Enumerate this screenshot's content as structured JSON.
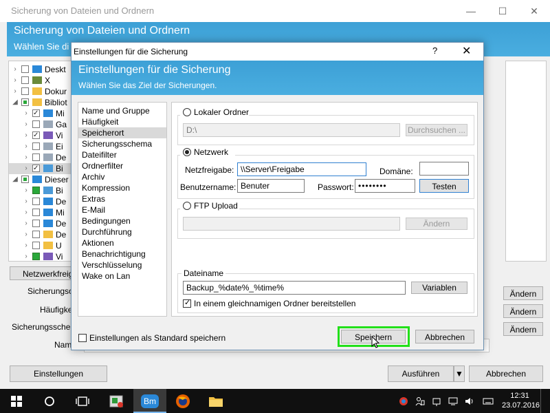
{
  "main": {
    "title": "Sicherung von Dateien und Ordnern",
    "banner_title": "Sicherung von Dateien und Ordnern",
    "banner_sub": "Wählen Sie di",
    "tree": [
      {
        "label": "Deskt",
        "depth": 0,
        "state": "none",
        "icon": "desktop"
      },
      {
        "label": "X",
        "depth": 0,
        "state": "none",
        "icon": "user"
      },
      {
        "label": "Dokur",
        "depth": 0,
        "state": "none",
        "icon": "folder"
      },
      {
        "label": "Bibliot",
        "depth": 0,
        "state": "part",
        "icon": "library",
        "expanded": true
      },
      {
        "label": "Mi",
        "depth": 1,
        "state": "checked",
        "icon": "music"
      },
      {
        "label": "Ga",
        "depth": 1,
        "state": "none",
        "icon": "doc"
      },
      {
        "label": "Vi",
        "depth": 1,
        "state": "checked",
        "icon": "video"
      },
      {
        "label": "Ei",
        "depth": 1,
        "state": "none",
        "icon": "doc"
      },
      {
        "label": "De",
        "depth": 1,
        "state": "none",
        "icon": "doc"
      },
      {
        "label": "Bi",
        "depth": 1,
        "state": "checked",
        "icon": "image",
        "selected": true
      },
      {
        "label": "Dieser",
        "depth": 0,
        "state": "part",
        "icon": "pc",
        "expanded": true
      },
      {
        "label": "Bi",
        "depth": 1,
        "state": "full",
        "icon": "image"
      },
      {
        "label": "De",
        "depth": 1,
        "state": "none",
        "icon": "download"
      },
      {
        "label": "Mi",
        "depth": 1,
        "state": "none",
        "icon": "music"
      },
      {
        "label": "De",
        "depth": 1,
        "state": "none",
        "icon": "desktop"
      },
      {
        "label": "De",
        "depth": 1,
        "state": "none",
        "icon": "folder"
      },
      {
        "label": "U",
        "depth": 1,
        "state": "none",
        "icon": "folder"
      },
      {
        "label": "Vi",
        "depth": 1,
        "state": "full",
        "icon": "video"
      }
    ],
    "netzwerkfreigabe_btn": "Netzwerkfreiga",
    "label_sicherungsort": "Sicherungsor",
    "label_haeufigkeit": "Häufigkei",
    "label_schema": "Sicherungsschema",
    "label_name": "Nam",
    "aendern1": "Ändern",
    "aendern2": "Ändern",
    "aendern3": "Ändern",
    "einstellungen_btn": "Einstellungen",
    "ausfuehren_btn": "Ausführen",
    "abbrechen_btn": "Abbrechen"
  },
  "dialog": {
    "title": "Einstellungen für die Sicherung",
    "help": "?",
    "close": "✕",
    "banner_title": "Einstellungen für die Sicherung",
    "banner_sub": "Wählen Sie das Ziel der Sicherungen.",
    "nav": [
      {
        "label": "Name und Gruppe"
      },
      {
        "label": "Häufigkeit"
      },
      {
        "label": "Speicherort",
        "selected": true
      },
      {
        "label": "Sicherungsschema"
      },
      {
        "label": "Dateifilter"
      },
      {
        "label": "Ordnerfilter"
      },
      {
        "label": "Archiv"
      },
      {
        "label": "Kompression"
      },
      {
        "label": "Extras"
      },
      {
        "label": "E-Mail"
      },
      {
        "label": "Bedingungen"
      },
      {
        "label": "Durchführung"
      },
      {
        "label": "Aktionen"
      },
      {
        "label": "Benachrichtigung"
      },
      {
        "label": "Verschlüsselung"
      },
      {
        "label": "Wake on Lan"
      }
    ],
    "local": {
      "radio_label": "Lokaler Ordner",
      "path_value": "D:\\",
      "browse_btn": "Durchsuchen ..."
    },
    "network": {
      "radio_label": "Netzwerk",
      "share_label": "Netzfreigabe:",
      "share_value": "\\\\Server\\Freigabe",
      "domain_label": "Domäne:",
      "domain_value": "",
      "user_label": "Benutzername:",
      "user_value": "Benuter",
      "password_label": "Passwort:",
      "password_value": "••••••••",
      "test_btn": "Testen"
    },
    "ftp": {
      "radio_label": "FTP Upload",
      "value": "",
      "change_btn": "Ändern"
    },
    "filename": {
      "label": "Dateiname",
      "value": "Backup_%date%_%time%",
      "variables_btn": "Variablen",
      "same_folder_label": "In einem gleichnamigen Ordner bereitstellen"
    },
    "default_label": "Einstellungen als Standard speichern",
    "save_btn": "Speichern",
    "cancel_btn": "Abbrechen",
    "accent_highlight": "#22e01a"
  },
  "taskbar": {
    "clock_time": "12:31",
    "clock_date": "23.07.2016",
    "bm_label": "Bm"
  }
}
